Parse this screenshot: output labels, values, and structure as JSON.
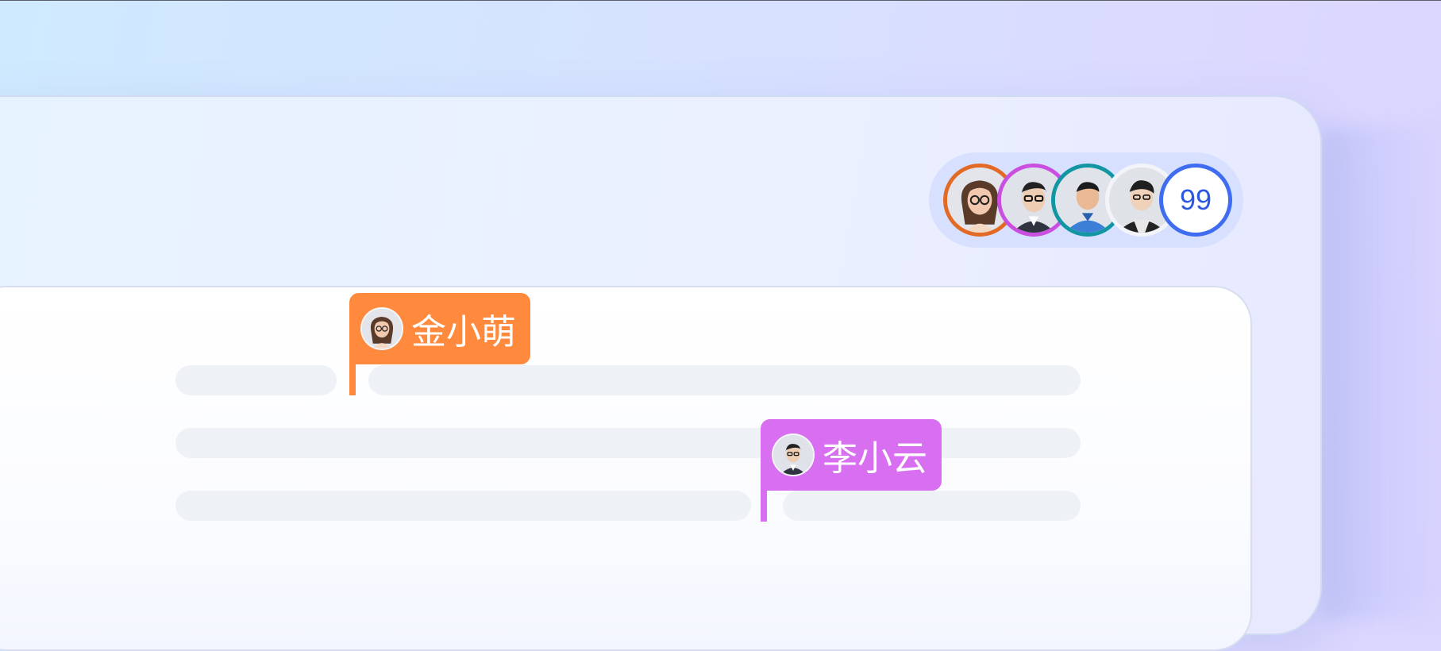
{
  "collaborators": {
    "avatars": [
      {
        "name": "person-1",
        "ring_color": "#e26a24",
        "icon": "avatar-woman-glasses"
      },
      {
        "name": "person-2",
        "ring_color": "#c84fe0",
        "icon": "avatar-man-glasses"
      },
      {
        "name": "person-3",
        "ring_color": "#1296a3",
        "icon": "avatar-man-blue"
      },
      {
        "name": "person-4",
        "ring_color": "#ffffff",
        "icon": "avatar-man-dark"
      }
    ],
    "overflow_count": "99"
  },
  "cursors": [
    {
      "user": "金小萌",
      "color": "#ff8a3d",
      "icon": "avatar-woman-glasses"
    },
    {
      "user": "李小云",
      "color": "#d86ef0",
      "icon": "avatar-man-glasses"
    }
  ]
}
